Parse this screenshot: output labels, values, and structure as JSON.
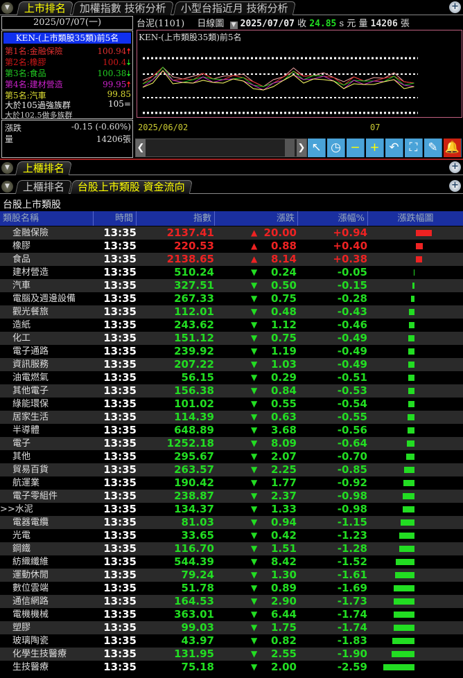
{
  "top_tabs": [
    "上市排名",
    "加權指數 技術分析",
    "小型台指近月 技術分析"
  ],
  "left_panel": {
    "date": "2025/07/07(一)",
    "title": "KEN-(上市類股35類)前5名",
    "ranks": [
      {
        "label": "第1名:金融保險",
        "value": "100.94",
        "arrow": "up",
        "color": "#e03030"
      },
      {
        "label": "第2名:橡膠",
        "value": "100.4",
        "arrow": "down",
        "color": "#d01818"
      },
      {
        "label": "第3名:食品",
        "value": "100.38",
        "arrow": "down",
        "color": "#22cc22"
      },
      {
        "label": "第4名:建材營造",
        "value": "99.95",
        "arrow": "up",
        "color": "#cc22cc"
      },
      {
        "label": "第5名:汽車",
        "value": "99.85",
        "arrow": "none",
        "color": "#dddd33"
      }
    ],
    "strong_label": "大於105過強族群",
    "strong_value": "105=",
    "bull_label": "大於102.5做多族群",
    "change_label": "漲跌",
    "change_value": "-0.15 (-0.60%)",
    "volume_label": "量",
    "volume_value": "14206張"
  },
  "chart_header": {
    "stock": "台泥(1101)",
    "period": "日線圖",
    "date": "2025/07/07",
    "close_label": "收",
    "close": "24.85",
    "unit": "s 元",
    "vol_label": "量",
    "vol": "14206",
    "vol_unit": "張",
    "chart_title": "KEN-(上市類股35類)前5名",
    "x_start": "2025/06/02",
    "x_mid": "07"
  },
  "toolbar": [
    "↖",
    "◷",
    "−",
    "+",
    "↶",
    "⛶",
    "✎",
    "🔔"
  ],
  "otc_tab": "上櫃排名",
  "bottom_tabs": [
    "上櫃排名",
    "台股上市類股 資金流向"
  ],
  "table_title": "台股上市類股",
  "columns": [
    "類股名稱",
    "時間",
    "指數",
    "漲跌",
    "漲幅%",
    "漲跌幅圖"
  ],
  "up_color": "#ee2222",
  "down_color": "#22dd22",
  "rows": [
    [
      "金融保險",
      "13:35",
      "2137.41",
      "20.00",
      "+0.94"
    ],
    [
      "橡膠",
      "13:35",
      "220.53",
      "0.88",
      "+0.40"
    ],
    [
      "食品",
      "13:35",
      "2138.65",
      "8.14",
      "+0.38"
    ],
    [
      "建材營造",
      "13:35",
      "510.24",
      "0.24",
      "-0.05"
    ],
    [
      "汽車",
      "13:35",
      "327.51",
      "0.50",
      "-0.15"
    ],
    [
      "電腦及週邊設備",
      "13:35",
      "267.33",
      "0.75",
      "-0.28"
    ],
    [
      "觀光餐旅",
      "13:35",
      "112.01",
      "0.48",
      "-0.43"
    ],
    [
      "造紙",
      "13:35",
      "243.62",
      "1.12",
      "-0.46"
    ],
    [
      "化工",
      "13:35",
      "151.12",
      "0.75",
      "-0.49"
    ],
    [
      "電子通路",
      "13:35",
      "239.92",
      "1.19",
      "-0.49"
    ],
    [
      "資訊服務",
      "13:35",
      "207.22",
      "1.03",
      "-0.49"
    ],
    [
      "油電燃氣",
      "13:35",
      "56.15",
      "0.29",
      "-0.51"
    ],
    [
      "其他電子",
      "13:35",
      "156.38",
      "0.84",
      "-0.53"
    ],
    [
      "綠能環保",
      "13:35",
      "101.02",
      "0.55",
      "-0.54"
    ],
    [
      "居家生活",
      "13:35",
      "114.39",
      "0.63",
      "-0.55"
    ],
    [
      "半導體",
      "13:35",
      "648.89",
      "3.68",
      "-0.56"
    ],
    [
      "電子",
      "13:35",
      "1252.18",
      "8.09",
      "-0.64"
    ],
    [
      "其他",
      "13:35",
      "295.67",
      "2.07",
      "-0.70"
    ],
    [
      "貿易百貨",
      "13:35",
      "263.57",
      "2.25",
      "-0.85"
    ],
    [
      "航運業",
      "13:35",
      "190.42",
      "1.77",
      "-0.92"
    ],
    [
      "電子零組件",
      "13:35",
      "238.87",
      "2.37",
      "-0.98"
    ],
    [
      ">>水泥",
      "13:35",
      "134.37",
      "1.33",
      "-0.98"
    ],
    [
      "電器電纜",
      "13:35",
      "81.03",
      "0.94",
      "-1.15"
    ],
    [
      "光電",
      "13:35",
      "33.65",
      "0.42",
      "-1.23"
    ],
    [
      "鋼鐵",
      "13:35",
      "116.70",
      "1.51",
      "-1.28"
    ],
    [
      "紡織纖維",
      "13:35",
      "544.39",
      "8.42",
      "-1.52"
    ],
    [
      "運動休閒",
      "13:35",
      "79.24",
      "1.30",
      "-1.61"
    ],
    [
      "數位雲端",
      "13:35",
      "51.78",
      "0.89",
      "-1.69"
    ],
    [
      "通信網路",
      "13:35",
      "164.53",
      "2.90",
      "-1.73"
    ],
    [
      "電機機械",
      "13:35",
      "363.01",
      "6.44",
      "-1.74"
    ],
    [
      "塑膠",
      "13:35",
      "99.03",
      "1.75",
      "-1.74"
    ],
    [
      "玻璃陶瓷",
      "13:35",
      "43.97",
      "0.82",
      "-1.83"
    ],
    [
      "化學生技醫療",
      "13:35",
      "131.95",
      "2.55",
      "-1.90"
    ],
    [
      "生技醫療",
      "13:35",
      "75.18",
      "2.00",
      "-2.59"
    ]
  ]
}
